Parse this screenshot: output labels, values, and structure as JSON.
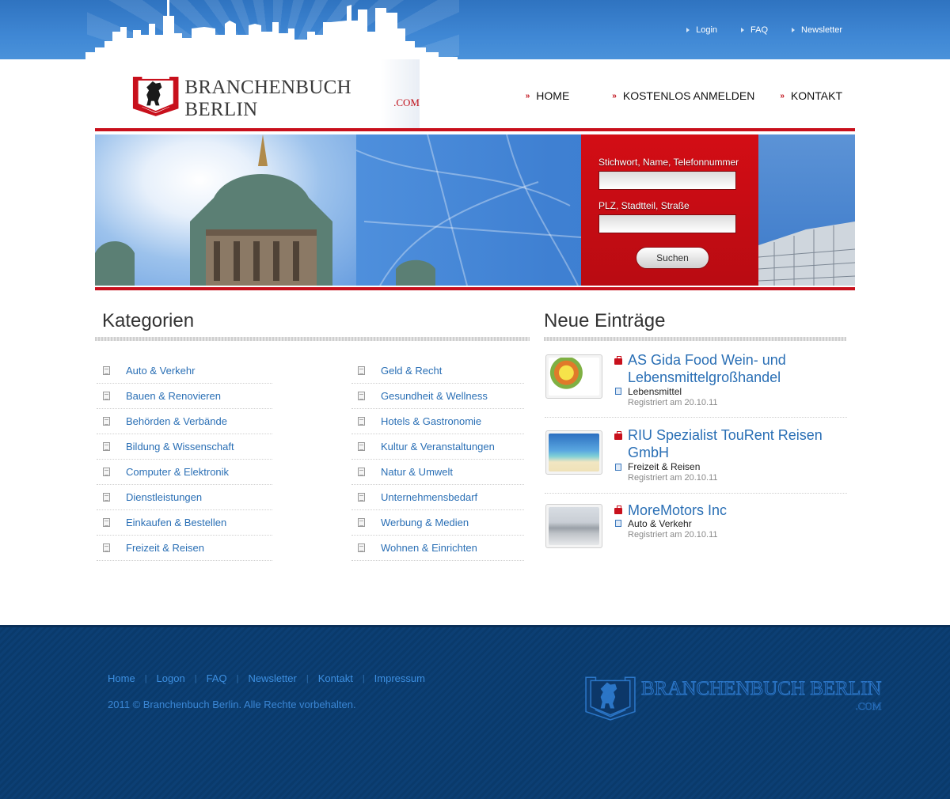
{
  "top_links": [
    {
      "label": "Login"
    },
    {
      "label": "FAQ"
    },
    {
      "label": "Newsletter"
    }
  ],
  "logo": {
    "text": "BRANCHENBUCH BERLIN",
    "suffix": ".COM"
  },
  "main_nav": [
    {
      "label": "HOME"
    },
    {
      "label": "KOSTENLOS ANMELDEN"
    },
    {
      "label": "KONTAKT"
    }
  ],
  "search": {
    "keyword_label": "Stichwort, Name, Telefonnummer",
    "keyword_value": "",
    "location_label": "PLZ, Stadtteil, Straße",
    "location_value": "",
    "button_label": "Suchen"
  },
  "categories": {
    "title": "Kategorien",
    "left": [
      "Auto & Verkehr",
      "Bauen & Renovieren",
      "Behörden & Verbände",
      "Bildung & Wissenschaft",
      "Computer & Elektronik",
      "Dienstleistungen",
      "Einkaufen & Bestellen",
      "Freizeit & Reisen"
    ],
    "right": [
      "Geld & Recht",
      "Gesundheit & Wellness",
      "Hotels & Gastronomie",
      "Kultur & Veranstaltungen",
      "Natur & Umwelt",
      "Unternehmensbedarf",
      "Werbung & Medien",
      "Wohnen & Einrichten"
    ]
  },
  "new_entries": {
    "title": "Neue Einträge",
    "items": [
      {
        "title_line1": "AS Gida Food Wein- und",
        "title_line2": "Lebensmittelgroßhandel",
        "category": "Lebensmittel",
        "registered": "Registriert am 20.10.11",
        "thumb_icon": "food-photo"
      },
      {
        "title_line1": "RIU Spezialist TouRent Reisen",
        "title_line2": "GmbH",
        "category": "Freizeit & Reisen",
        "registered": "Registriert am 20.10.11",
        "thumb_icon": "beach-photo"
      },
      {
        "title_line1": "MoreMotors Inc",
        "title_line2": "",
        "category": "Auto & Verkehr",
        "registered": "Registriert am 20.10.11",
        "thumb_icon": "car-photo"
      }
    ]
  },
  "footer": {
    "links": [
      "Home",
      "Logon",
      "FAQ",
      "Newsletter",
      "Kontakt",
      "Impressum"
    ],
    "separator": "|",
    "copyright": "2011 © Branchenbuch Berlin. Alle Rechte vorbehalten.",
    "logo_text": "BRANCHENBUCH BERLIN",
    "logo_suffix": ".COM"
  },
  "colors": {
    "brand_red": "#c8101c",
    "link_blue": "#2a6fb5",
    "header_blue": "#3f87d4",
    "footer_navy": "#0c3f74"
  }
}
